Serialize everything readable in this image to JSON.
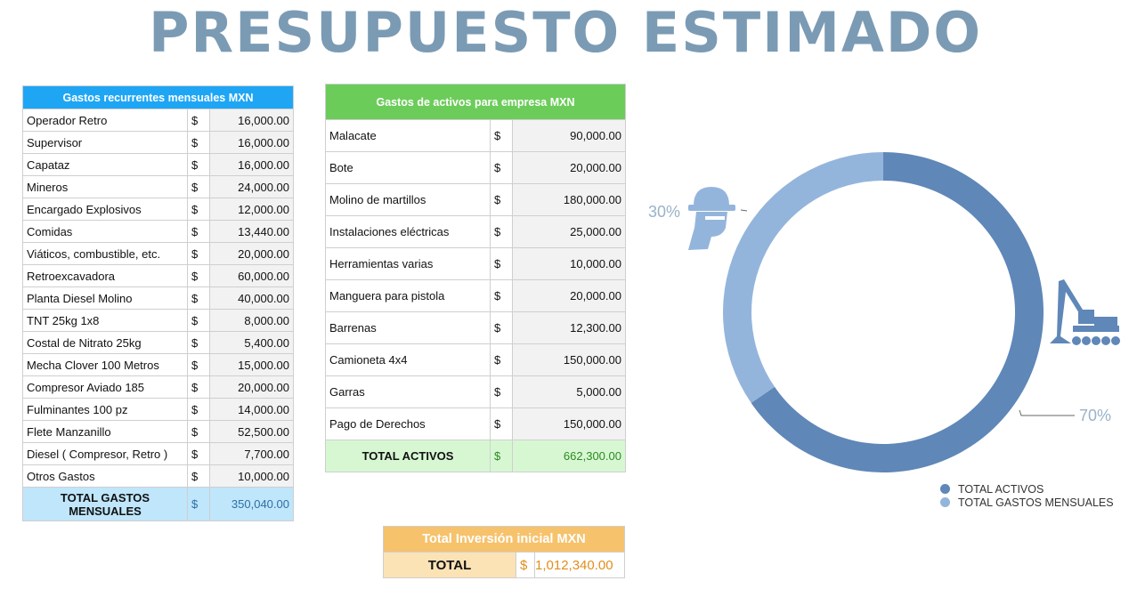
{
  "title": "PRESUPUESTO ESTIMADO",
  "recurrentes": {
    "header": "Gastos recurrentes mensuales MXN",
    "currency": "$",
    "rows": [
      {
        "label": "Operador Retro",
        "amount": "16,000.00"
      },
      {
        "label": "Supervisor",
        "amount": "16,000.00"
      },
      {
        "label": "Capataz",
        "amount": "16,000.00"
      },
      {
        "label": "Mineros",
        "amount": "24,000.00"
      },
      {
        "label": "Encargado Explosivos",
        "amount": "12,000.00"
      },
      {
        "label": "Comidas",
        "amount": "13,440.00"
      },
      {
        "label": "Viáticos, combustible, etc.",
        "amount": "20,000.00"
      },
      {
        "label": "Retroexcavadora",
        "amount": "60,000.00"
      },
      {
        "label": "Planta Diesel Molino",
        "amount": "40,000.00"
      },
      {
        "label": "TNT 25kg 1x8",
        "amount": "8,000.00"
      },
      {
        "label": "Costal de Nitrato  25kg",
        "amount": "5,400.00"
      },
      {
        "label": "Mecha Clover 100 Metros",
        "amount": "15,000.00"
      },
      {
        "label": "Compresor Aviado 185",
        "amount": "20,000.00"
      },
      {
        "label": "Fulminantes 100 pz",
        "amount": "14,000.00"
      },
      {
        "label": "Flete Manzanillo",
        "amount": "52,500.00"
      },
      {
        "label": "Diesel ( Compresor, Retro )",
        "amount": "7,700.00"
      },
      {
        "label": "Otros Gastos",
        "amount": "10,000.00"
      }
    ],
    "total_label": "TOTAL GASTOS MENSUALES",
    "total_amount": "350,040.00"
  },
  "activos": {
    "header": "Gastos de activos para empresa MXN",
    "currency": "$",
    "rows": [
      {
        "label": "Malacate",
        "amount": "90,000.00"
      },
      {
        "label": "Bote",
        "amount": "20,000.00"
      },
      {
        "label": "Molino de martillos",
        "amount": "180,000.00"
      },
      {
        "label": "Instalaciones eléctricas",
        "amount": "25,000.00"
      },
      {
        "label": "Herramientas varias",
        "amount": "10,000.00"
      },
      {
        "label": "Manguera para pistola",
        "amount": "20,000.00"
      },
      {
        "label": "Barrenas",
        "amount": "12,300.00"
      },
      {
        "label": "Camioneta 4x4",
        "amount": "150,000.00"
      },
      {
        "label": "Garras",
        "amount": "5,000.00"
      },
      {
        "label": "Pago de Derechos",
        "amount": "150,000.00"
      }
    ],
    "total_label": "TOTAL ACTIVOS",
    "total_amount": "662,300.00"
  },
  "inversion": {
    "header": "Total Inversión inicial MXN",
    "total_label": "TOTAL",
    "currency": "$",
    "total_amount": "1,012,340.00"
  },
  "chart_data": {
    "type": "pie",
    "donut": true,
    "categories": [
      "TOTAL ACTIVOS",
      "TOTAL GASTOS MENSUALES"
    ],
    "values": [
      662300,
      350040
    ],
    "percent_labels": [
      "70%",
      "30%"
    ],
    "colors": [
      "#5f87b8",
      "#94b5db"
    ],
    "legend_position": "bottom-right",
    "icons": [
      "excavator-icon",
      "worker-helmet-icon"
    ]
  }
}
